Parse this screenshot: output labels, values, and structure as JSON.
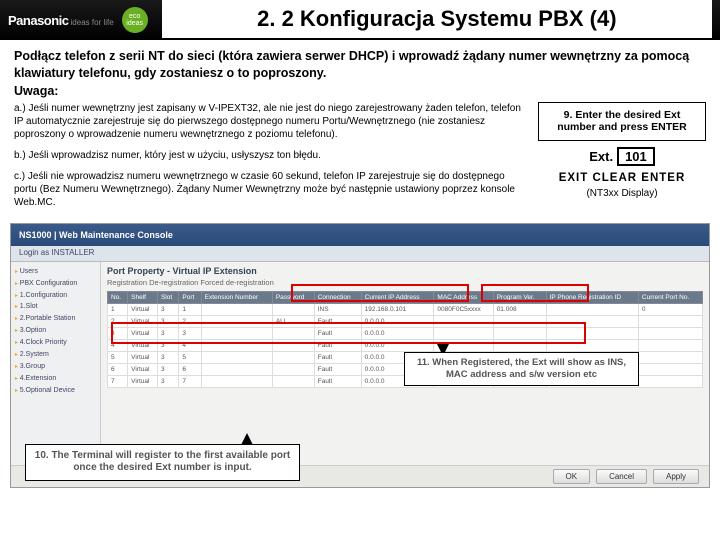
{
  "header": {
    "brand": "Panasonic",
    "tagline": "ideas for life",
    "eco": "eco ideas",
    "title": "2. 2 Konfiguracja Systemu PBX (4)"
  },
  "intro": "Podłącz telefon z serii NT do sieci (która zawiera serwer DHCP) i wprowadź żądany numer wewnętrzny za pomocą klawiatury telefonu, gdy zostaniesz o to poproszony.",
  "uwaga": "Uwaga:",
  "notes": {
    "a": "a.) Jeśli numer wewnętrzny jest zapisany w V-IPEXT32, ale nie jest do niego zarejestrowany żaden telefon, telefon IP automatycznie zarejestruje się do pierwszego dostępnego numeru Portu/Wewnętrznego (nie zostaniesz poproszony o wprowadzenie numeru wewnętrznego z poziomu telefonu).",
    "b": "b.) Jeśli wprowadzisz numer, który jest w użyciu, usłyszysz ton błędu.",
    "c": "c.) Jeśli nie wprowadzisz numeru wewnętrznego w czasie 60 sekund, telefon IP zarejestruje się do dostępnego portu (Bez Numeru Wewnętrznego). Żądany Numer Wewnętrzny może być następnie ustawiony poprzez konsole Web.MC."
  },
  "step9": {
    "text": "9. Enter the desired Ext number and press ENTER",
    "extLabel": "Ext.",
    "extVal": "101",
    "buttons": "EXIT   CLEAR   ENTER",
    "display": "(NT3xx Display)"
  },
  "screenshot": {
    "wintitle": "NS1000   |   Web Maintenance Console",
    "login": "Login as INSTALLER",
    "subtitle": "Port Property - Virtual IP Extension",
    "tabs": "Registration   De-registration   Forced de-registration",
    "side": [
      "Users",
      "PBX Configuration",
      "1.Configuration",
      "1.Slot",
      "2.Portable Station",
      "3.Option",
      "4.Clock Priority",
      "2.System",
      "3.Group",
      "4.Extension",
      "5.Optional Device"
    ],
    "cols": [
      "No.",
      "Shelf",
      "Slot",
      "Port",
      "Extension Number",
      "Password",
      "Connection",
      "Current IP Address",
      "MAC Address",
      "Program Ver.",
      "IP Phone Registration ID",
      "Current Port No."
    ],
    "rows": [
      [
        "1",
        "Virtual",
        "3",
        "1",
        "",
        "",
        "INS",
        "192.168.0.101",
        "0080F0C5xxxx",
        "01.008",
        "",
        "0"
      ],
      [
        "2",
        "Virtual",
        "3",
        "2",
        "",
        "ALL",
        "Fault",
        "0.0.0.0",
        "",
        "",
        "",
        ""
      ],
      [
        "3",
        "Virtual",
        "3",
        "3",
        "",
        "",
        "Fault",
        "0.0.0.0",
        "",
        "",
        "",
        ""
      ],
      [
        "4",
        "Virtual",
        "3",
        "4",
        "",
        "",
        "Fault",
        "0.0.0.0",
        "",
        "",
        "",
        ""
      ],
      [
        "5",
        "Virtual",
        "3",
        "5",
        "",
        "",
        "Fault",
        "0.0.0.0",
        "",
        "",
        "",
        ""
      ],
      [
        "6",
        "Virtual",
        "3",
        "6",
        "",
        "",
        "Fault",
        "0.0.0.0",
        "",
        "",
        "",
        ""
      ],
      [
        "7",
        "Virtual",
        "3",
        "7",
        "",
        "",
        "Fault",
        "0.0.0.0",
        "",
        "",
        "",
        ""
      ]
    ],
    "ok": "OK",
    "cancel": "Cancel",
    "apply": "Apply"
  },
  "call10": "10. The Terminal will register to the first available port once the desired Ext number is input.",
  "call11": "11. When Registered, the Ext will show as INS, MAC address and s/w version etc"
}
